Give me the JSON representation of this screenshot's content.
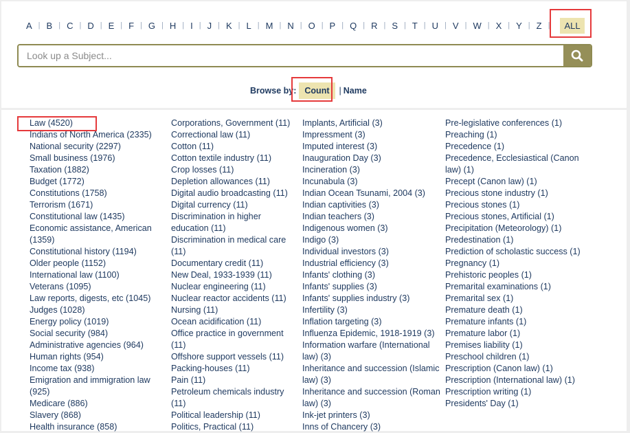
{
  "alphabet": {
    "letters": [
      "A",
      "B",
      "C",
      "D",
      "E",
      "F",
      "G",
      "H",
      "I",
      "J",
      "K",
      "L",
      "M",
      "N",
      "O",
      "P",
      "Q",
      "R",
      "S",
      "T",
      "U",
      "V",
      "W",
      "X",
      "Y",
      "Z"
    ],
    "all_label": "ALL",
    "selected": "ALL"
  },
  "search": {
    "placeholder": "Look up a Subject...",
    "value": "",
    "button_icon": "search-icon"
  },
  "browse": {
    "label": "Browse by:",
    "options": [
      "Count",
      "Name"
    ],
    "selected": "Count",
    "separator": "|"
  },
  "highlight_color": "#e5393b",
  "accent_color": "#958f58",
  "selected_bg": "#ede4b0",
  "subjects": {
    "columns": [
      [
        "Law (4520)",
        "Indians of North America (2335)",
        "National security (2297)",
        "Small business (1976)",
        "Taxation (1882)",
        "Budget (1772)",
        "Constitutions (1758)",
        "Terrorism (1671)",
        "Constitutional law (1435)",
        "Economic assistance, American (1359)",
        "Constitutional history (1194)",
        "Older people (1152)",
        "International law (1100)",
        "Veterans (1095)",
        "Law reports, digests, etc (1045)",
        "Judges (1028)",
        "Energy policy (1019)",
        "Social security (984)",
        "Administrative agencies (964)",
        "Human rights (954)",
        "Income tax (938)",
        "Emigration and immigration law (925)",
        "Medicare (886)",
        "Slavery (868)",
        "Health insurance (858)"
      ],
      [
        "Corporations, Government (11)",
        "Correctional law (11)",
        "Cotton (11)",
        "Cotton textile industry (11)",
        "Crop losses (11)",
        "Depletion allowances (11)",
        "Digital audio broadcasting (11)",
        "Digital currency (11)",
        "Discrimination in higher education (11)",
        "Discrimination in medical care (11)",
        "Documentary credit (11)",
        "New Deal, 1933-1939 (11)",
        "Nuclear engineering (11)",
        "Nuclear reactor accidents (11)",
        "Nursing (11)",
        "Ocean acidification (11)",
        "Office practice in government (11)",
        "Offshore support vessels (11)",
        "Packing-houses (11)",
        "Pain (11)",
        "Petroleum chemicals industry (11)",
        "Political leadership (11)",
        "Politics, Practical (11)"
      ],
      [
        "Implants, Artificial (3)",
        "Impressment (3)",
        "Imputed interest (3)",
        "Inauguration Day (3)",
        "Incineration (3)",
        "Incunabula (3)",
        "Indian Ocean Tsunami, 2004 (3)",
        "Indian captivities (3)",
        "Indian teachers (3)",
        "Indigenous women (3)",
        "Indigo (3)",
        "Individual investors (3)",
        "Industrial efficiency (3)",
        "Infants' clothing (3)",
        "Infants' supplies (3)",
        "Infants' supplies industry (3)",
        "Infertility (3)",
        "Inflation targeting (3)",
        "Influenza Epidemic, 1918-1919 (3)",
        "Information warfare (International law) (3)",
        "Inheritance and succession (Islamic law) (3)",
        "Inheritance and succession (Roman law) (3)",
        "Ink-jet printers (3)",
        "Inns of Chancery (3)"
      ],
      [
        "Pre-legislative conferences (1)",
        "Preaching (1)",
        "Precedence (1)",
        "Precedence, Ecclesiastical (Canon law) (1)",
        "Precept (Canon law) (1)",
        "Precious stone industry (1)",
        "Precious stones (1)",
        "Precious stones, Artificial (1)",
        "Precipitation (Meteorology) (1)",
        "Predestination (1)",
        "Prediction of scholastic success (1)",
        "Pregnancy (1)",
        "Prehistoric peoples (1)",
        "Premarital examinations (1)",
        "Premarital sex (1)",
        "Premature death (1)",
        "Premature infants (1)",
        "Premature labor (1)",
        "Premises liability (1)",
        "Preschool children (1)",
        "Prescription (Canon law) (1)",
        "Prescription (International law) (1)",
        "Prescription writing (1)",
        "Presidents' Day (1)"
      ]
    ]
  }
}
